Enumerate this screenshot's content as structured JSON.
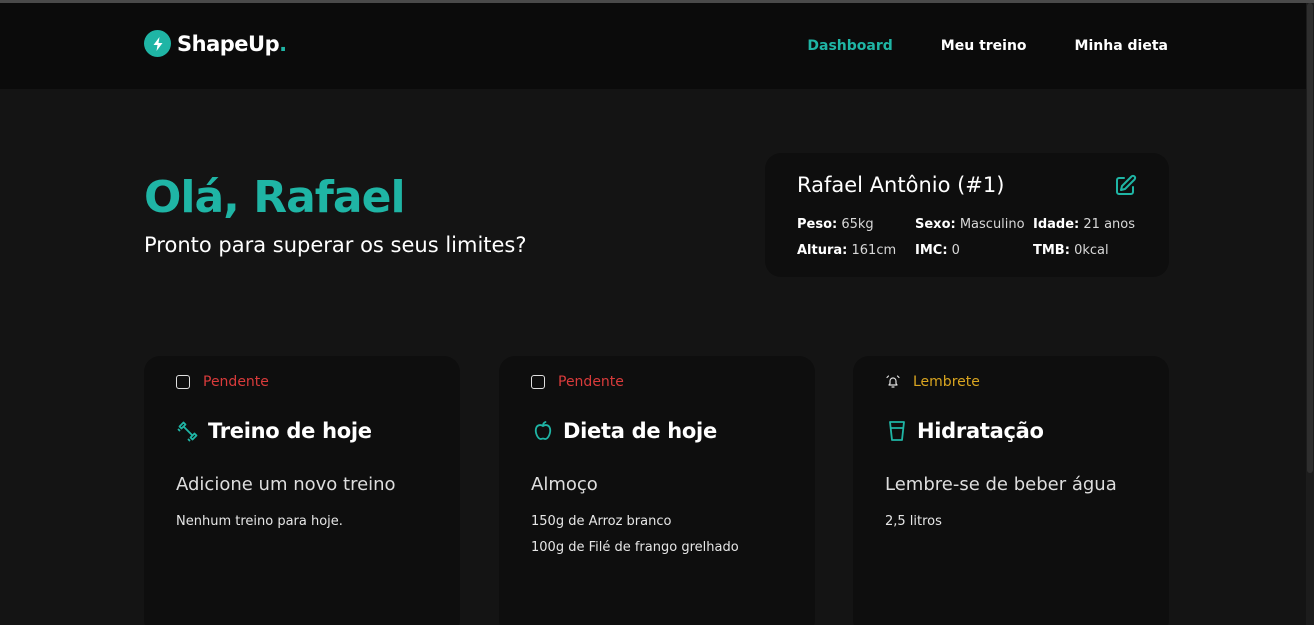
{
  "brand": {
    "name": "ShapeUp",
    "dot": ".",
    "accent": "#1fb5a5"
  },
  "nav": {
    "dashboard": "Dashboard",
    "meu_treino": "Meu treino",
    "minha_dieta": "Minha dieta"
  },
  "greeting": {
    "title": "Olá, Rafael",
    "subtitle": "Pronto para superar os seus limites?"
  },
  "profile": {
    "name": "Rafael Antônio (#1)",
    "peso_label": "Peso:",
    "peso_value": "65kg",
    "sexo_label": "Sexo:",
    "sexo_value": "Masculino",
    "idade_label": "Idade:",
    "idade_value": "21 anos",
    "altura_label": "Altura:",
    "altura_value": "161cm",
    "imc_label": "IMC:",
    "imc_value": "0",
    "tmb_label": "TMB:",
    "tmb_value": "0kcal"
  },
  "cards": {
    "treino": {
      "status": "Pendente",
      "title": "Treino de hoje",
      "subtitle": "Adicione um novo treino",
      "line1": "Nenhum treino para hoje."
    },
    "dieta": {
      "status": "Pendente",
      "title": "Dieta de hoje",
      "subtitle": "Almoço",
      "line1": "150g de Arroz branco",
      "line2": "100g de Filé de frango grelhado"
    },
    "hidratacao": {
      "status": "Lembrete",
      "title": "Hidratação",
      "subtitle": "Lembre-se de beber água",
      "line1": "2,5 litros"
    }
  },
  "colors": {
    "pending": "#d93b3b",
    "reminder": "#d9a520",
    "background": "#141414",
    "card": "#0e0e0e"
  },
  "icons": [
    "bolt-icon",
    "edit-icon",
    "dumbbell-icon",
    "apple-icon",
    "glass-icon",
    "bell-icon"
  ]
}
